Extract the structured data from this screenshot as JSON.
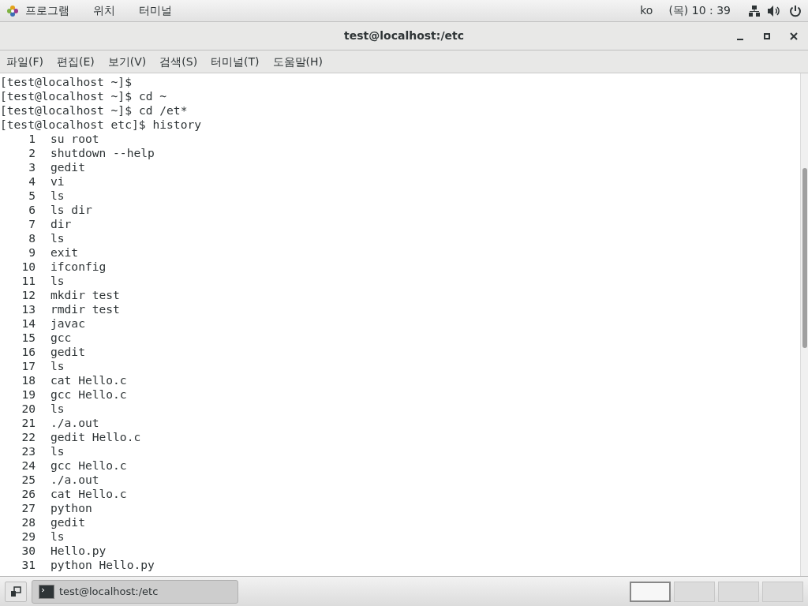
{
  "top_bar": {
    "menus": [
      "프로그램",
      "위치",
      "터미널"
    ],
    "language": "ko",
    "clock": "(목) 10 : 39"
  },
  "window": {
    "title": "test@localhost:/etc"
  },
  "menu_bar": [
    "파일(F)",
    "편집(E)",
    "보기(V)",
    "검색(S)",
    "터미널(T)",
    "도움말(H)"
  ],
  "terminal": {
    "prompts": [
      {
        "prompt": "[test@localhost ~]$"
      },
      {
        "prompt": "[test@localhost ~]$",
        "command": "cd ~"
      },
      {
        "prompt": "[test@localhost ~]$",
        "command": "cd /et*"
      },
      {
        "prompt": "[test@localhost etc]$",
        "command": "history"
      }
    ],
    "history": [
      {
        "number": "1",
        "command": "su root"
      },
      {
        "number": "2",
        "command": "shutdown --help"
      },
      {
        "number": "3",
        "command": "gedit"
      },
      {
        "number": "4",
        "command": "vi"
      },
      {
        "number": "5",
        "command": "ls"
      },
      {
        "number": "6",
        "command": "ls dir"
      },
      {
        "number": "7",
        "command": "dir"
      },
      {
        "number": "8",
        "command": "ls"
      },
      {
        "number": "9",
        "command": "exit"
      },
      {
        "number": "10",
        "command": "ifconfig"
      },
      {
        "number": "11",
        "command": "ls"
      },
      {
        "number": "12",
        "command": "mkdir test"
      },
      {
        "number": "13",
        "command": "rmdir test"
      },
      {
        "number": "14",
        "command": "javac"
      },
      {
        "number": "15",
        "command": "gcc"
      },
      {
        "number": "16",
        "command": "gedit"
      },
      {
        "number": "17",
        "command": "ls"
      },
      {
        "number": "18",
        "command": "cat Hello.c"
      },
      {
        "number": "19",
        "command": "gcc Hello.c"
      },
      {
        "number": "20",
        "command": "ls"
      },
      {
        "number": "21",
        "command": "./a.out"
      },
      {
        "number": "22",
        "command": "gedit Hello.c"
      },
      {
        "number": "23",
        "command": "ls"
      },
      {
        "number": "24",
        "command": "gcc Hello.c"
      },
      {
        "number": "25",
        "command": "./a.out"
      },
      {
        "number": "26",
        "command": "cat Hello.c"
      },
      {
        "number": "27",
        "command": "python"
      },
      {
        "number": "28",
        "command": "gedit"
      },
      {
        "number": "29",
        "command": "ls"
      },
      {
        "number": "30",
        "command": "Hello.py"
      },
      {
        "number": "31",
        "command": "python Hello.py"
      }
    ]
  },
  "taskbar": {
    "task": "test@localhost:/etc",
    "workspaces": [
      {
        "selected": true
      },
      {
        "selected": false
      },
      {
        "selected": false
      },
      {
        "selected": false
      }
    ]
  }
}
